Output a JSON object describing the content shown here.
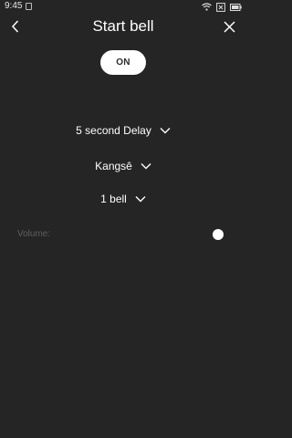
{
  "status_bar": {
    "time": "9:45",
    "icons": [
      "app-notification-icon",
      "wifi-icon",
      "sim-x-icon",
      "battery-icon"
    ]
  },
  "header": {
    "title": "Start bell",
    "back_icon": "chevron-left-icon",
    "close_icon": "close-icon"
  },
  "toggle": {
    "label": "ON"
  },
  "dropdowns": {
    "delay": {
      "value": "5 second Delay"
    },
    "sound": {
      "value": "Kangsê"
    },
    "count": {
      "value": "1 bell"
    }
  },
  "volume": {
    "label": "Volume:",
    "level": 1.0
  },
  "colors": {
    "background": "#252525",
    "text": "#ffffff",
    "muted": "#5f5f5f"
  }
}
